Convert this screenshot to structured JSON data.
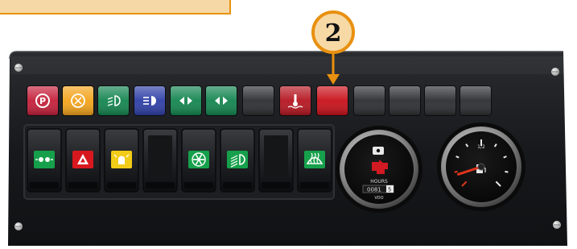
{
  "callout": {
    "number": "2"
  },
  "hour_meter": {
    "label": "HOURS",
    "digits": "0081",
    "last_digit": "5",
    "brand": "VDO"
  },
  "fuel_gauge": {
    "half_mark": "1/2",
    "needle_level": 0.1
  },
  "colors": {
    "callout_fill": "#f7d9a6",
    "callout_stroke": "#e8900f",
    "panel": "#15171a",
    "red_lamp": "#d0101a",
    "amber_lamp": "#f0a21c",
    "green_lamp": "#1a8c52",
    "blue_lamp": "#2b3fa8"
  },
  "indicator_lamps": [
    {
      "name": "parking-brake-lamp",
      "icon": "parking-brake-icon",
      "color": "#c41f3a"
    },
    {
      "name": "brake-warning-lamp",
      "icon": "brake-warning-icon",
      "color": "#f3a31b"
    },
    {
      "name": "low-beam-lamp",
      "icon": "low-beam-icon",
      "color": "#13854f"
    },
    {
      "name": "high-beam-lamp",
      "icon": "high-beam-icon",
      "color": "#2e3fa6"
    },
    {
      "name": "turn-signal-lamp-1",
      "icon": "turn-signal-icon",
      "color": "#13854f"
    },
    {
      "name": "turn-signal-lamp-2",
      "icon": "turn-signal-icon",
      "color": "#13854f"
    },
    {
      "name": "blank-lamp-1",
      "icon": "",
      "color": "#2b2d30"
    },
    {
      "name": "coolant-temp-lamp",
      "icon": "coolant-temp-icon",
      "color": "#b51620"
    },
    {
      "name": "indicated-red-lamp",
      "icon": "",
      "color": "#c8101a"
    },
    {
      "name": "blank-lamp-2",
      "icon": "",
      "color": "#2b2d30"
    },
    {
      "name": "blank-lamp-3",
      "icon": "",
      "color": "#2b2d30"
    },
    {
      "name": "blank-lamp-4",
      "icon": "",
      "color": "#2b2d30"
    },
    {
      "name": "blank-lamp-5",
      "icon": "",
      "color": "#2b2d30"
    }
  ],
  "rocker_switches": [
    {
      "name": "side-lights-switch",
      "icon": "side-lights-icon",
      "color": "#16a04b"
    },
    {
      "name": "hazard-switch",
      "icon": "hazard-icon",
      "color": "#d7191f"
    },
    {
      "name": "beacon-switch",
      "icon": "beacon-icon",
      "color": "#f2cc17"
    },
    {
      "name": "blank-switch-1",
      "icon": "",
      "color": ""
    },
    {
      "name": "fan-switch",
      "icon": "fan-icon",
      "color": "#16a04b"
    },
    {
      "name": "work-light-switch",
      "icon": "work-light-icon",
      "color": "#16a04b"
    },
    {
      "name": "blank-switch-2",
      "icon": "",
      "color": ""
    },
    {
      "name": "front-defrost-switch",
      "icon": "front-defrost-icon",
      "color": "#16a04b"
    }
  ]
}
